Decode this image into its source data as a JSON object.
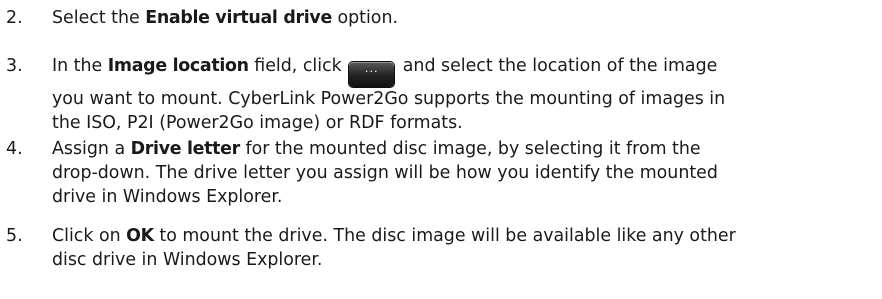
{
  "steps": [
    {
      "number": "2.",
      "lines": [
        {
          "before": "Select the ",
          "bold": "Enable virtual drive",
          "after": " option."
        }
      ]
    },
    {
      "number": "3.",
      "line1_before": "In the ",
      "line1_bold": "Image location",
      "line1_middle": " field, click ",
      "button_label": "···",
      "line1_after": " and select the location of the image",
      "line2": "you want to mount. CyberLink Power2Go supports the mounting of images in",
      "line3": "the ISO, P2I (Power2Go image) or RDF formats."
    },
    {
      "number": "4.",
      "line1_before": "Assign a ",
      "line1_bold": "Drive letter",
      "line1_after": " for the mounted disc image, by selecting it from the",
      "line2": "drop-down. The drive letter you assign will be how you identify the mounted",
      "line3": "drive in Windows Explorer."
    },
    {
      "number": "5.",
      "line1_before": "Click on ",
      "line1_bold": "OK",
      "line1_after": " to mount the drive. The disc image will be available like any other",
      "line2": "disc drive in Windows Explorer."
    }
  ]
}
